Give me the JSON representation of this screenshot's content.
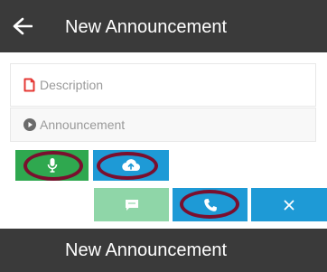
{
  "header": {
    "title": "New Announcement",
    "back_icon": "arrow-left-icon"
  },
  "form": {
    "description": {
      "placeholder": "Description",
      "icon": "document-icon",
      "icon_color": "#e53935"
    },
    "announcement": {
      "placeholder": "Announcement",
      "icon": "play-circle-icon",
      "icon_color": "#6b6b6b"
    }
  },
  "media_buttons": [
    {
      "name": "record-audio-button",
      "icon": "microphone-icon",
      "color": "#2fa84f"
    },
    {
      "name": "upload-button",
      "icon": "cloud-upload-icon",
      "color": "#1e9ad6"
    }
  ],
  "action_buttons": [
    {
      "name": "message-button",
      "icon": "chat-icon",
      "color": "#8fd6a8",
      "state": "disabled"
    },
    {
      "name": "call-button",
      "icon": "phone-icon",
      "color": "#1e9ad6"
    },
    {
      "name": "close-button",
      "icon": "close-icon",
      "color": "#1e9ad6"
    }
  ],
  "footer": {
    "title": "New Announcement"
  },
  "colors": {
    "app_bar": "#3a3a3a",
    "highlight_ring": "#7a0f2e"
  }
}
